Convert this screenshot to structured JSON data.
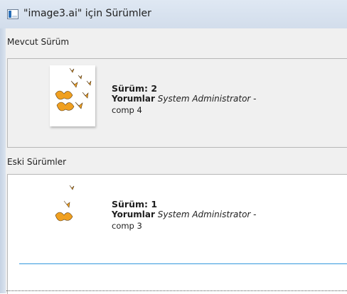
{
  "window": {
    "title": "\"image3.ai\" için Sürümler"
  },
  "current": {
    "section_label": "Mevcut Sürüm",
    "version_text": "Sürüm: 2",
    "comment_label": "Yorumlar",
    "author": "System Administrator",
    "separator": "-",
    "note": "comp 4"
  },
  "older": {
    "section_label": "Eski Sürümler",
    "items": [
      {
        "version_text": "Sürüm: 1",
        "comment_label": "Yorumlar",
        "author": "System Administrator",
        "separator": "-",
        "note": "comp 3"
      }
    ]
  },
  "colors": {
    "selection_line": "#3399dd",
    "butterfly": "#f0a020"
  },
  "icons": {
    "title": "window-app-icon",
    "thumbnail": "butterflies-thumbnail"
  }
}
